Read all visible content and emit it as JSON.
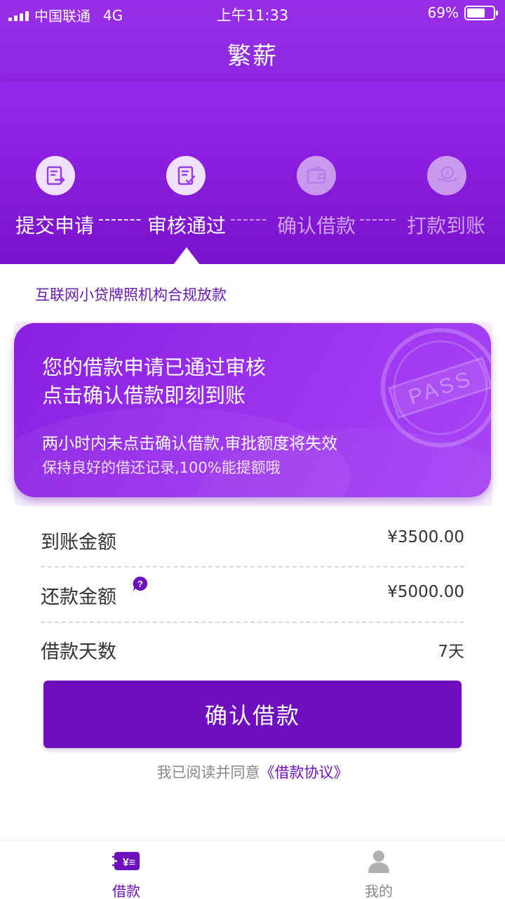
{
  "status_bar": {
    "carrier": "中国联通",
    "network": "4G",
    "time": "上午11:33",
    "battery": "69%",
    "battery_level": 0.69
  },
  "app": {
    "title": "繁薪"
  },
  "steps": [
    {
      "label": "提交申请",
      "state": "done",
      "icon": "document-transfer-icon"
    },
    {
      "label": "审核通过",
      "state": "done",
      "icon": "document-check-icon"
    },
    {
      "label": "确认借款",
      "state": "pending",
      "icon": "wallet-icon"
    },
    {
      "label": "打款到账",
      "state": "pending",
      "icon": "yen-hand-icon"
    }
  ],
  "step_connectors": [
    "-------",
    "------",
    "------"
  ],
  "license_text": "互联网小贷牌照机构合规放款",
  "card": {
    "line1": "您的借款申请已通过审核",
    "line2": "点击确认借款即刻到账",
    "line3": "两小时内未点击确认借款,审批额度将失效",
    "line4": "保持良好的借还记录,100%能提额哦",
    "stamp_text": "PASS"
  },
  "details": [
    {
      "label": "到账金额",
      "value": "¥3500.00"
    },
    {
      "label": "还款金额",
      "value": "¥5000.00"
    },
    {
      "label": "借款天数",
      "value": "7天"
    }
  ],
  "confirm_button": "确认借款",
  "agreement": {
    "prefix": "我已阅读并同意",
    "link": "《借款协议》"
  },
  "tabs": [
    {
      "label": "借款",
      "active": true
    },
    {
      "label": "我的",
      "active": false
    }
  ],
  "colors": {
    "primary": "#6e0fbf",
    "header": "#9424e8"
  }
}
